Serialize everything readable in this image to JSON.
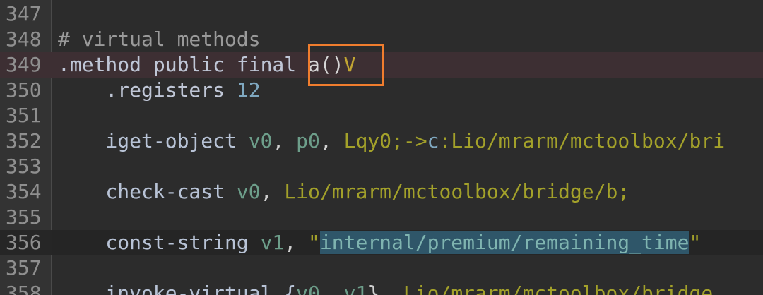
{
  "editor": {
    "lines": [
      {
        "num": "347",
        "tokens": []
      },
      {
        "num": "348",
        "tokens": [
          {
            "t": "# virtual methods",
            "c": "comment"
          }
        ]
      },
      {
        "num": "349",
        "hl": "method",
        "tokens": [
          {
            "t": ".method public final ",
            "c": "dir"
          },
          {
            "t": "a()",
            "c": "id"
          },
          {
            "t": "V",
            "c": "type"
          }
        ]
      },
      {
        "num": "350",
        "tokens": [
          {
            "t": "    .registers ",
            "c": "dir"
          },
          {
            "t": "12",
            "c": "num"
          }
        ]
      },
      {
        "num": "351",
        "tokens": []
      },
      {
        "num": "352",
        "tokens": [
          {
            "t": "    iget-object ",
            "c": "op"
          },
          {
            "t": "v0",
            "c": "reg"
          },
          {
            "t": ", ",
            "c": "punc"
          },
          {
            "t": "p0",
            "c": "reg"
          },
          {
            "t": ", ",
            "c": "punc"
          },
          {
            "t": "Lqy0;",
            "c": "class"
          },
          {
            "t": "->",
            "c": "arrow"
          },
          {
            "t": "c",
            "c": "member"
          },
          {
            "t": ":Lio/mrarm/mctoolbox/bri",
            "c": "class"
          }
        ]
      },
      {
        "num": "353",
        "tokens": []
      },
      {
        "num": "354",
        "tokens": [
          {
            "t": "    check-cast ",
            "c": "op"
          },
          {
            "t": "v0",
            "c": "reg"
          },
          {
            "t": ", ",
            "c": "punc"
          },
          {
            "t": "Lio/mrarm/mctoolbox/bridge/b;",
            "c": "class"
          }
        ]
      },
      {
        "num": "355",
        "tokens": []
      },
      {
        "num": "356",
        "hl": "current",
        "tokens": [
          {
            "t": "    const-string ",
            "c": "op"
          },
          {
            "t": "v1",
            "c": "reg"
          },
          {
            "t": ", ",
            "c": "punc"
          },
          {
            "t": "\"",
            "c": "str"
          },
          {
            "t": "internal/premium/remaining_time",
            "c": "sel"
          },
          {
            "t": "\"",
            "c": "str"
          }
        ]
      },
      {
        "num": "357",
        "tokens": []
      },
      {
        "num": "358",
        "tokens": [
          {
            "t": "    invoke-virtual {",
            "c": "op"
          },
          {
            "t": "v0",
            "c": "reg"
          },
          {
            "t": ", ",
            "c": "punc"
          },
          {
            "t": "v1",
            "c": "reg"
          },
          {
            "t": "}, ",
            "c": "punc"
          },
          {
            "t": "Lio/mrarm/mctoolbox/bridge",
            "c": "class"
          }
        ]
      }
    ]
  }
}
